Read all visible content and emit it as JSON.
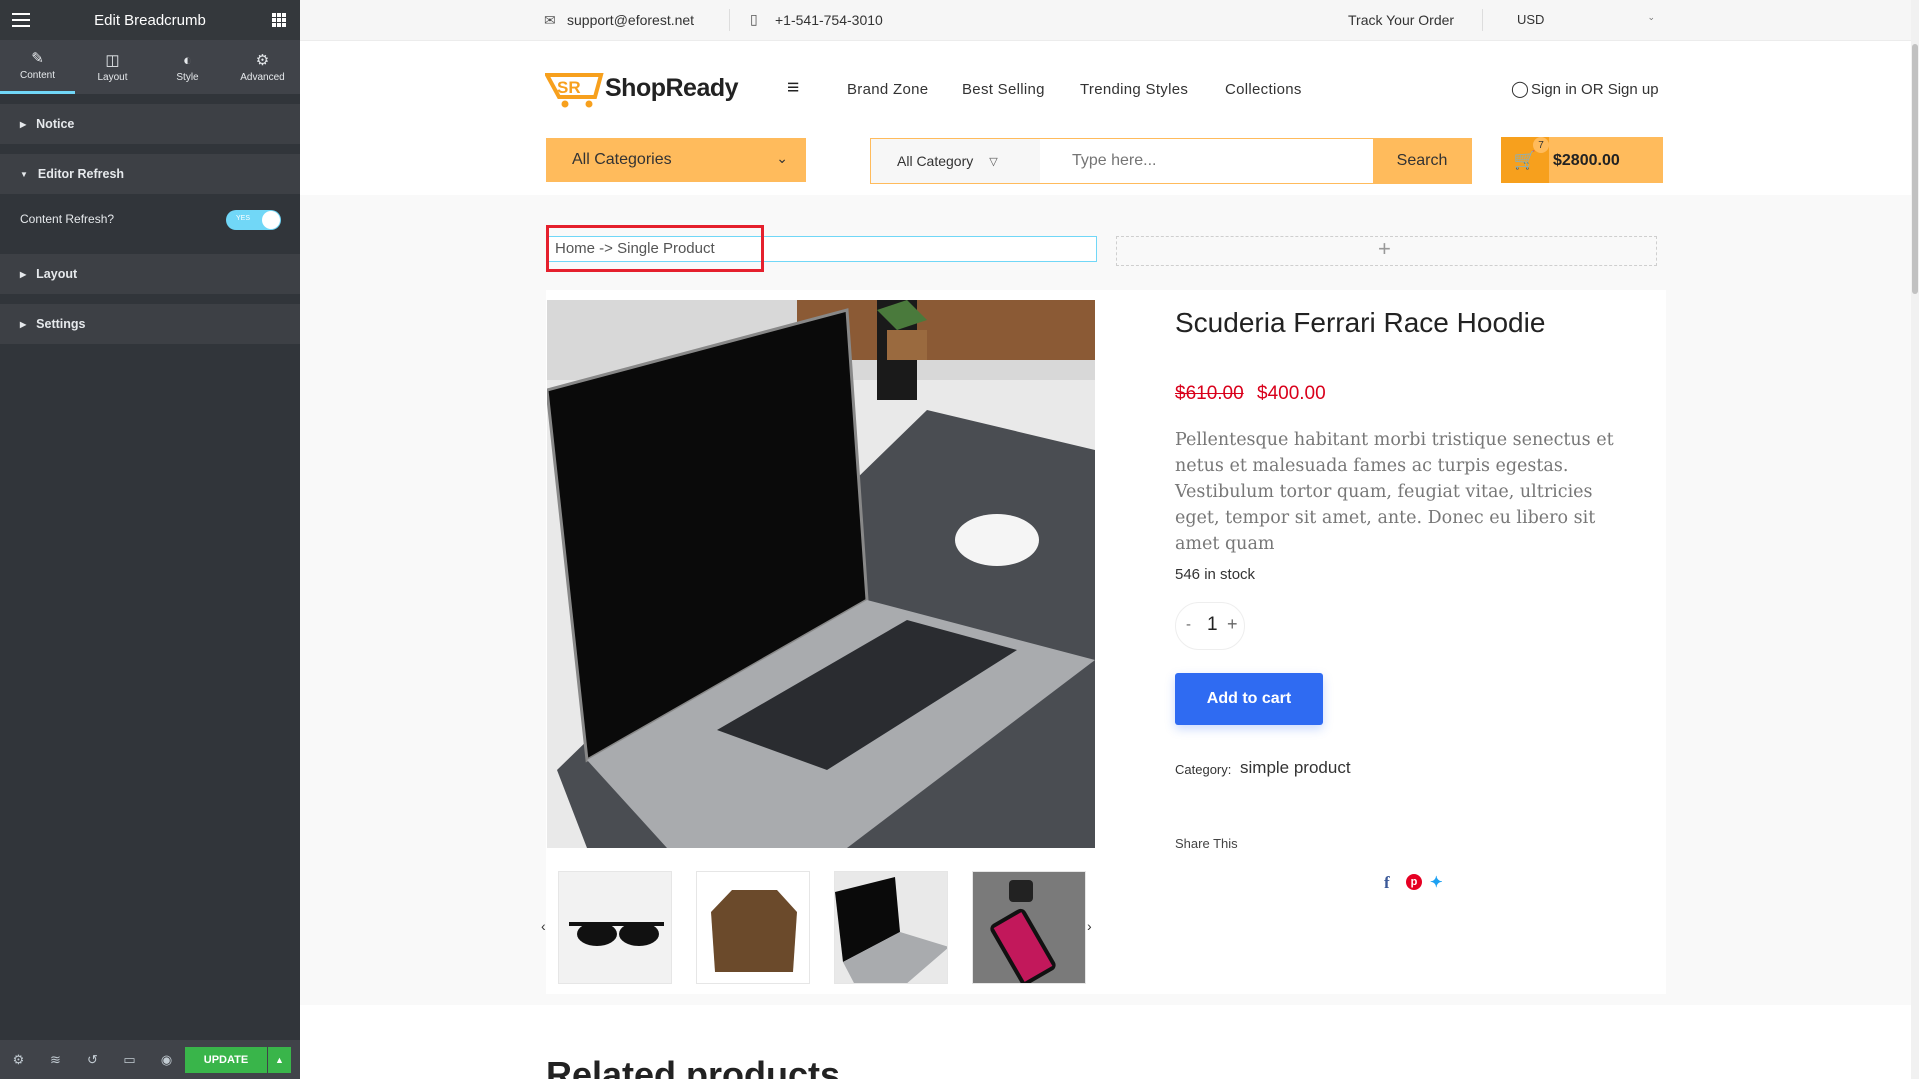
{
  "panel": {
    "title": "Edit Breadcrumb",
    "tabs": [
      {
        "label": "Content",
        "icon": "pencil-icon"
      },
      {
        "label": "Layout",
        "icon": "layout-icon"
      },
      {
        "label": "Style",
        "icon": "contrast-icon"
      },
      {
        "label": "Advanced",
        "icon": "gear-icon"
      }
    ],
    "sections": {
      "notice": "Notice",
      "editor_refresh": "Editor Refresh",
      "layout": "Layout",
      "settings": "Settings"
    },
    "content_refresh_label": "Content Refresh?",
    "toggle_text": "YES",
    "update_label": "UPDATE"
  },
  "topbar": {
    "email": "support@eforest.net",
    "phone": "+1-541-754-3010",
    "track": "Track Your Order",
    "currency": "USD"
  },
  "header": {
    "logo_text": "ShopReady",
    "nav": [
      "Brand Zone",
      "Best Selling",
      "Trending Styles",
      "Collections"
    ],
    "signin": "Sign in OR Sign up",
    "all_categories": "All Categories",
    "search_category": "All Category",
    "search_placeholder": "Type here...",
    "search_button": "Search",
    "cart_count": "7",
    "cart_total": "$2800.00"
  },
  "breadcrumb": {
    "text": "Home -> Single Product"
  },
  "product": {
    "title": "Scuderia Ferrari Race Hoodie",
    "old_price": "$610.00",
    "price": "$400.00",
    "description": "Pellentesque habitant morbi tristique senectus et netus et malesuada fames ac turpis egestas. Vestibulum tortor quam, feugiat vitae, ultricies eget, tempor sit amet, ante. Donec eu libero sit amet quam",
    "stock": "546 in stock",
    "quantity": "1",
    "add_to_cart": "Add to cart",
    "category_label": "Category:",
    "category": "simple product",
    "share_label": "Share This"
  },
  "related_title": "Related products",
  "colors": {
    "accent": "#ffbb5c",
    "cart_button": "#2f6bf2",
    "price": "#d9001b",
    "panel": "#31353a",
    "highlight": "#e5202d"
  }
}
